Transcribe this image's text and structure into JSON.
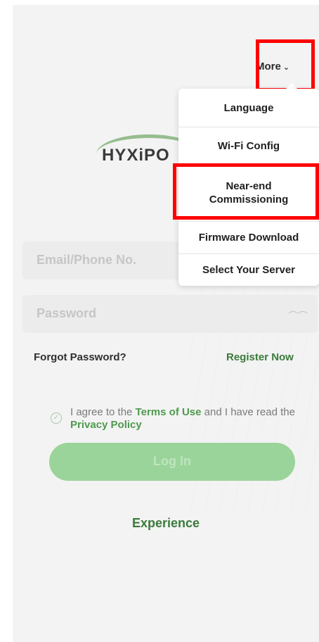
{
  "logo": {
    "text": "HYXiPO"
  },
  "header": {
    "more_label": "More",
    "more_chevron": "⌄"
  },
  "menu": {
    "items": [
      {
        "label": "Language"
      },
      {
        "label": "Wi-Fi Config"
      },
      {
        "label": "Near-end\nCommissioning"
      },
      {
        "label": "Firmware Download"
      },
      {
        "label": "Select Your Server"
      }
    ]
  },
  "form": {
    "email_placeholder": "Email/Phone No.",
    "password_placeholder": "Password",
    "forgot_label": "Forgot Password?",
    "register_label": "Register Now",
    "agree_prefix": "I agree to the",
    "terms_label": "Terms of Use",
    "agree_mid": "and I have read the",
    "privacy_label": "Privacy Policy",
    "login_label": "Log In",
    "experience_label": "Experience"
  },
  "colors": {
    "accent_green": "#3b7a3b",
    "button_green": "#9ad49a",
    "highlight_red": "#ff0000"
  },
  "icons": {
    "eye": "eye-closed-icon",
    "check": "check-circle-icon",
    "chevron": "chevron-down-icon"
  }
}
